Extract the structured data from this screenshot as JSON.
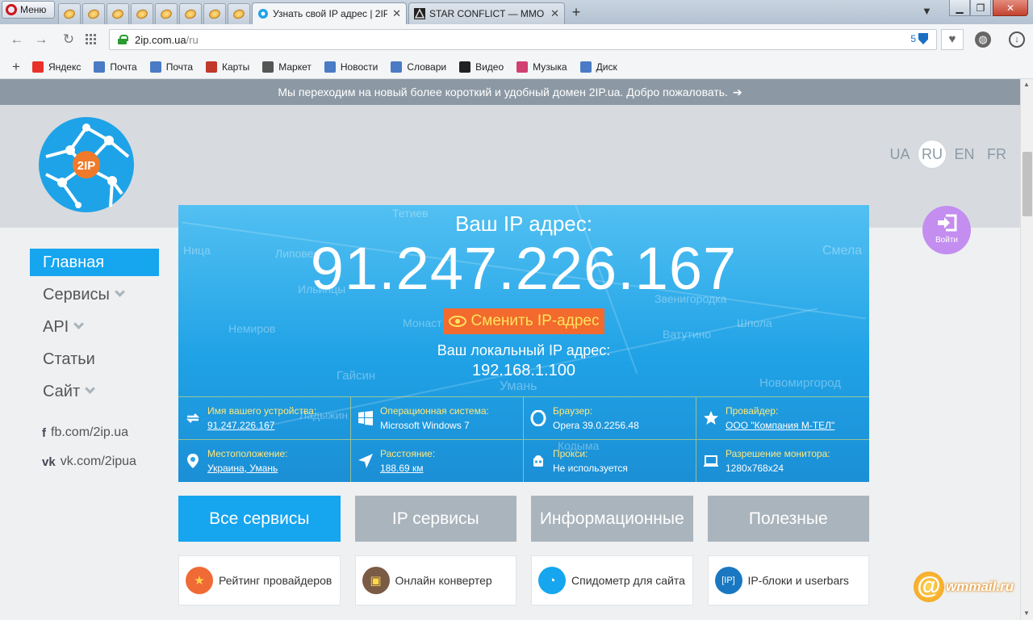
{
  "browser": {
    "menu_label": "Меню",
    "tabs": [
      {
        "title": "Узнать свой IP адрес | 2IP",
        "close": "✕"
      },
      {
        "title": "STAR CONFLICT — MMO",
        "close": "✕"
      }
    ],
    "new_tab": "+",
    "address": {
      "host": "2ip.com.ua",
      "path": "/ru",
      "badge_count": "5"
    },
    "bookmarks": [
      "Яндекс",
      "Почта",
      "Почта",
      "Карты",
      "Маркет",
      "Новости",
      "Словари",
      "Видео",
      "Музыка",
      "Диск"
    ],
    "bookmark_icon_colors": [
      "#e8322b",
      "#4a7bc4",
      "#4a7bc4",
      "#c0392b",
      "#555",
      "#4a7bc4",
      "#4a7bc4",
      "#222",
      "#d14070",
      "#4a7bc4"
    ]
  },
  "page": {
    "banner": "Мы переходим на новый более короткий и удобный домен 2IP.ua. Добро пожаловать.",
    "logo_text": "2IP",
    "languages": [
      "UA",
      "RU",
      "EN",
      "FR"
    ],
    "selected_language": "RU",
    "login_label": "Войти",
    "nav": [
      {
        "label": "Главная",
        "dropdown": false,
        "active": true
      },
      {
        "label": "Сервисы",
        "dropdown": true,
        "active": false
      },
      {
        "label": "API",
        "dropdown": true,
        "active": false
      },
      {
        "label": "Статьи",
        "dropdown": false,
        "active": false
      },
      {
        "label": "Сайт",
        "dropdown": true,
        "active": false
      }
    ],
    "social": [
      {
        "icon": "facebook-icon",
        "glyph": "f",
        "label": "fb.com/2ip.ua"
      },
      {
        "icon": "vk-icon",
        "glyph": "vk",
        "label": "vk.com/2ipua"
      }
    ],
    "hero": {
      "title": "Ваш IP адрес:",
      "ip": "91.247.226.167",
      "change_button": "Сменить IP-адрес",
      "local_label": "Ваш локальный IP адрес:",
      "local_ip": "192.168.1.100",
      "map_labels": [
        "Тетиев",
        "Липовец",
        "Ильинцы",
        "Немиров",
        "Монаст",
        "Гайсин",
        "Умань",
        "Звенигородка",
        "Ватутино",
        "Шпола",
        "Смела",
        "Новомиргород",
        "Ладыжин",
        "Кодыма",
        "Ница"
      ],
      "info": [
        {
          "icon": "device-icon",
          "label": "Имя вашего устройства:",
          "value": "91.247.226.167",
          "link": true
        },
        {
          "icon": "windows-icon",
          "label": "Операционная система:",
          "value": "Microsoft Windows 7",
          "link": false
        },
        {
          "icon": "opera-icon",
          "label": "Браузер:",
          "value": "Opera 39.0.2256.48",
          "link": false
        },
        {
          "icon": "star-icon",
          "label": "Провайдер:",
          "value": "ООО \"Компания М-ТЕЛ\"",
          "link": true
        },
        {
          "icon": "location-pin-icon",
          "label": "Местоположение:",
          "value": "Украина, Умань",
          "link": true
        },
        {
          "icon": "navigation-arrow-icon",
          "label": "Расстояние:",
          "value": "188.69 км",
          "link": true
        },
        {
          "icon": "proxy-icon",
          "label": "Прокси:",
          "value": "Не используется",
          "link": false
        },
        {
          "icon": "monitor-icon",
          "label": "Разрешение монитора:",
          "value": "1280x768x24",
          "link": false
        }
      ]
    },
    "categories": [
      "Все сервисы",
      "IP сервисы",
      "Информационные",
      "Полезные"
    ],
    "selected_category": "Все сервисы",
    "services": [
      {
        "icon": "star-icon",
        "glyph": "★",
        "color": "#f06a35",
        "label": "Рейтинг провайдеров"
      },
      {
        "icon": "floppy-icon",
        "glyph": "▣",
        "color": "#7a5b45",
        "label": "Онлайн конвертер"
      },
      {
        "icon": "speedometer-icon",
        "glyph": "◔",
        "color": "#16a5ef",
        "label": "Спидометр для сайта"
      },
      {
        "icon": "ip-block-icon",
        "glyph": "[IP]",
        "color": "#1a78c2",
        "label": "IP-блоки и userbars"
      }
    ],
    "watermark": "wmmail.ru"
  }
}
